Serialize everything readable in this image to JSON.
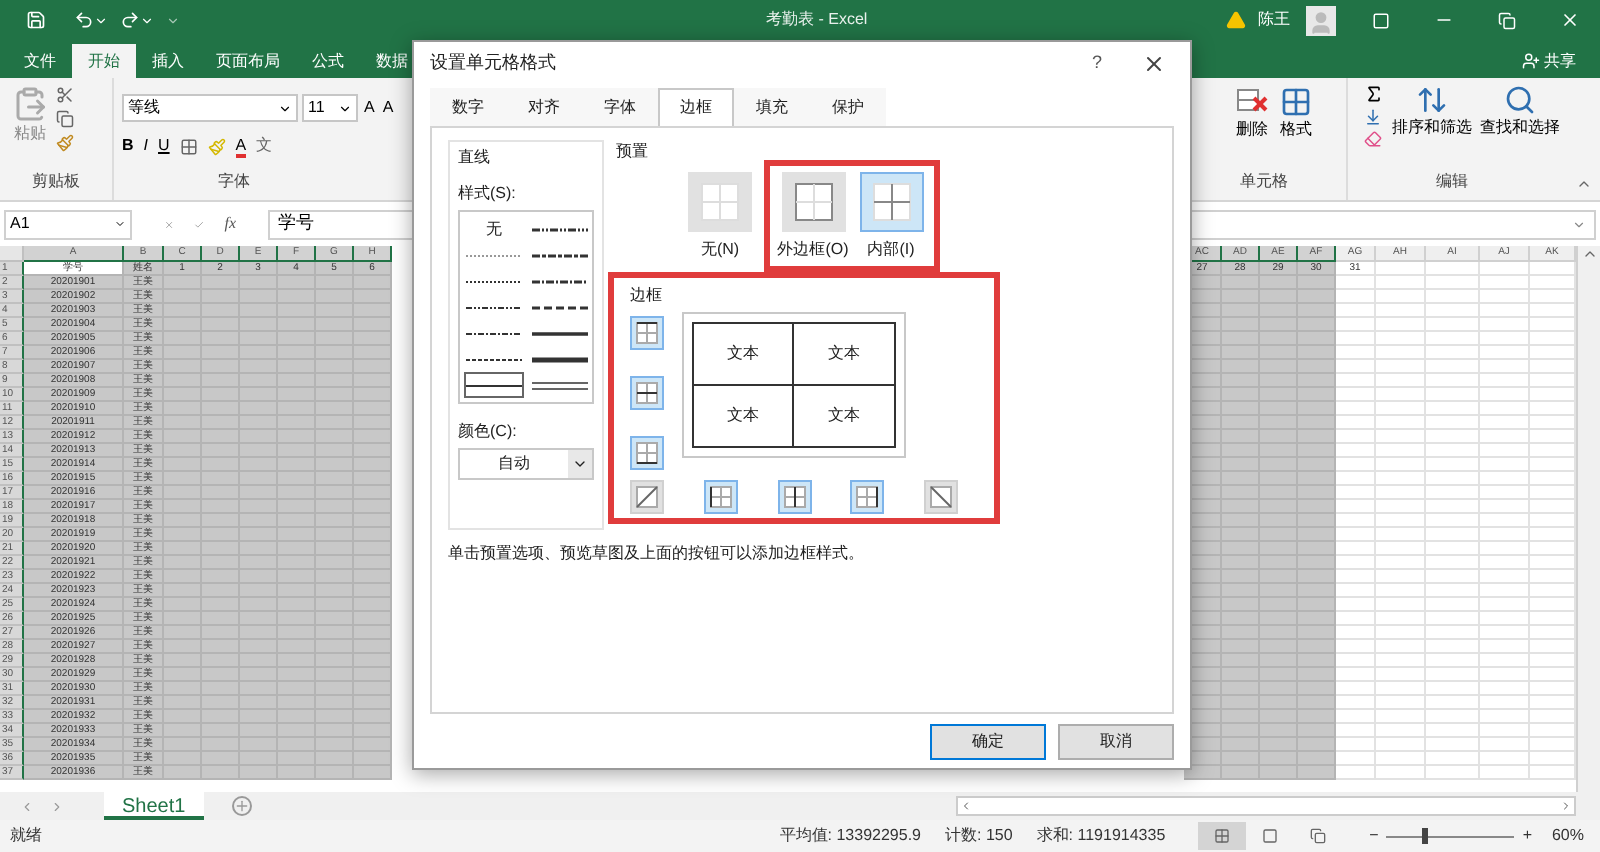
{
  "title_bar": {
    "title": "考勤表 - Excel",
    "user": "陈王"
  },
  "ribbon_tabs": [
    {
      "label": "文件",
      "selected": false
    },
    {
      "label": "开始",
      "selected": true
    },
    {
      "label": "插入",
      "selected": false
    },
    {
      "label": "页面布局",
      "selected": false
    },
    {
      "label": "公式",
      "selected": false
    },
    {
      "label": "数据",
      "selected": false
    }
  ],
  "share": "共享",
  "ribbon": {
    "paste": "粘贴",
    "clipboard_label": "剪贴板",
    "font_name": "等线",
    "font_size": "11",
    "grow_shrink": [
      "A",
      "A"
    ],
    "styles": [
      "B",
      "I",
      "U"
    ],
    "font_color": "A",
    "phonetic": "文",
    "font_label": "字体",
    "delete": "删除",
    "format": "格式",
    "cells_label": "单元格",
    "sort": "排序和筛选",
    "find": "查找和选择",
    "editing_label": "编辑"
  },
  "formula_bar": {
    "name_box": "A1",
    "fx": "fx",
    "content": "学号"
  },
  "sheet": {
    "left_columns": [
      {
        "label": "A",
        "selected": true
      },
      {
        "label": "B",
        "selected": true
      },
      {
        "label": "C",
        "selected": true
      },
      {
        "label": "D",
        "selected": true
      },
      {
        "label": "E",
        "selected": true
      },
      {
        "label": "F",
        "selected": true
      },
      {
        "label": "G",
        "selected": true
      },
      {
        "label": "H",
        "selected": true
      }
    ],
    "right_columns": [
      {
        "label": "AC",
        "selected": true
      },
      {
        "label": "AD",
        "selected": true
      },
      {
        "label": "AE",
        "selected": true
      },
      {
        "label": "AF",
        "selected": true
      },
      {
        "label": "AG",
        "selected": false
      },
      {
        "label": "AH",
        "selected": false
      },
      {
        "label": "AI",
        "selected": false
      },
      {
        "label": "AJ",
        "selected": false
      },
      {
        "label": "AK",
        "selected": false
      }
    ],
    "rows": [
      {
        "n": "1",
        "active": true,
        "cells": [
          "学号",
          "姓名",
          "1",
          "2",
          "3",
          "4",
          "5",
          "6"
        ],
        "right_cells": [
          "27",
          "28",
          "29",
          "30",
          "31"
        ]
      },
      {
        "n": "2",
        "cells": [
          "20201901",
          "王美"
        ]
      },
      {
        "n": "3",
        "cells": [
          "20201902",
          "王美"
        ]
      },
      {
        "n": "4",
        "cells": [
          "20201903",
          "王美"
        ]
      },
      {
        "n": "5",
        "cells": [
          "20201904",
          "王美"
        ]
      },
      {
        "n": "6",
        "cells": [
          "20201905",
          "王美"
        ]
      },
      {
        "n": "7",
        "cells": [
          "20201906",
          "王美"
        ]
      },
      {
        "n": "8",
        "cells": [
          "20201907",
          "王美"
        ]
      },
      {
        "n": "9",
        "cells": [
          "20201908",
          "王美"
        ]
      },
      {
        "n": "10",
        "cells": [
          "20201909",
          "王美"
        ]
      },
      {
        "n": "11",
        "cells": [
          "20201910",
          "王美"
        ]
      },
      {
        "n": "12",
        "cells": [
          "20201911",
          "王美"
        ]
      },
      {
        "n": "13",
        "cells": [
          "20201912",
          "王美"
        ]
      },
      {
        "n": "14",
        "cells": [
          "20201913",
          "王美"
        ]
      },
      {
        "n": "15",
        "cells": [
          "20201914",
          "王美"
        ]
      },
      {
        "n": "16",
        "cells": [
          "20201915",
          "王美"
        ]
      },
      {
        "n": "17",
        "cells": [
          "20201916",
          "王美"
        ]
      },
      {
        "n": "18",
        "cells": [
          "20201917",
          "王美"
        ]
      },
      {
        "n": "19",
        "cells": [
          "20201918",
          "王美"
        ]
      },
      {
        "n": "20",
        "cells": [
          "20201919",
          "王美"
        ]
      },
      {
        "n": "21",
        "cells": [
          "20201920",
          "王美"
        ]
      },
      {
        "n": "22",
        "cells": [
          "20201921",
          "王美"
        ]
      },
      {
        "n": "23",
        "cells": [
          "20201922",
          "王美"
        ]
      },
      {
        "n": "24",
        "cells": [
          "20201923",
          "王美"
        ]
      },
      {
        "n": "25",
        "cells": [
          "20201924",
          "王美"
        ]
      },
      {
        "n": "26",
        "cells": [
          "20201925",
          "王美"
        ]
      },
      {
        "n": "27",
        "cells": [
          "20201926",
          "王美"
        ]
      },
      {
        "n": "28",
        "cells": [
          "20201927",
          "王美"
        ]
      },
      {
        "n": "29",
        "cells": [
          "20201928",
          "王美"
        ]
      },
      {
        "n": "30",
        "cells": [
          "20201929",
          "王美"
        ]
      },
      {
        "n": "31",
        "cells": [
          "20201930",
          "王美"
        ]
      },
      {
        "n": "32",
        "cells": [
          "20201931",
          "王美"
        ]
      },
      {
        "n": "33",
        "cells": [
          "20201932",
          "王美"
        ]
      },
      {
        "n": "34",
        "cells": [
          "20201933",
          "王美"
        ]
      },
      {
        "n": "35",
        "cells": [
          "20201934",
          "王美"
        ]
      },
      {
        "n": "36",
        "cells": [
          "20201935",
          "王美"
        ]
      },
      {
        "n": "37",
        "cells": [
          "20201936",
          "王美"
        ]
      }
    ]
  },
  "sheet_tabs": [
    {
      "label": "Sheet1",
      "selected": true
    }
  ],
  "status_bar": {
    "ready": "就绪",
    "average": "平均值: 13392295.9",
    "count": "计数: 150",
    "sum": "求和: 1191914335",
    "views": [
      {
        "kind": "normal",
        "selected": true
      },
      {
        "kind": "layout",
        "selected": false
      },
      {
        "kind": "pagebreak",
        "selected": false
      }
    ],
    "zoom_minus": "−",
    "zoom": {
      "level": 0.3
    },
    "zoom_plus": "+",
    "zoom_text": "60%"
  },
  "dialog": {
    "title": "设置单元格格式",
    "help": "?",
    "tabs": [
      {
        "label": "数字",
        "selected": false
      },
      {
        "label": "对齐",
        "selected": false
      },
      {
        "label": "字体",
        "selected": false
      },
      {
        "label": "边框",
        "selected": true
      },
      {
        "label": "填充",
        "selected": false
      },
      {
        "label": "保护",
        "selected": false
      }
    ],
    "line_label": "直线",
    "style_label": "样式(S):",
    "styles": [
      {
        "kind": "none",
        "label": "无",
        "selected": false
      },
      {
        "kind": "hair",
        "selected": false
      },
      {
        "kind": "dotted",
        "selected": false
      },
      {
        "kind": "dashdotdot",
        "selected": false
      },
      {
        "kind": "dashdot",
        "selected": false
      },
      {
        "kind": "dashed",
        "selected": false
      },
      {
        "kind": "thin",
        "selected": true
      },
      {
        "kind": "mdashdotdot",
        "selected": false
      },
      {
        "kind": "slantdashdot",
        "selected": false
      },
      {
        "kind": "mdashdot",
        "selected": false
      },
      {
        "kind": "mdashed",
        "selected": false
      },
      {
        "kind": "medium",
        "selected": false
      },
      {
        "kind": "thick",
        "selected": false
      },
      {
        "kind": "double",
        "selected": false
      }
    ],
    "color_label": "颜色(C):",
    "color_value": "自动",
    "preset_label": "预置",
    "presets": [
      {
        "kind": "none",
        "label": "无(N)",
        "selected": false,
        "highlighted": false
      },
      {
        "kind": "outline",
        "label": "外边框(O)",
        "selected": false,
        "highlighted": true
      },
      {
        "kind": "inside",
        "label": "内部(I)",
        "selected": true,
        "highlighted": true
      }
    ],
    "border_section": {
      "label": "边框",
      "highlighted": true,
      "side_toggles": [
        {
          "kind": "top",
          "on": true
        },
        {
          "kind": "middle",
          "on": true
        },
        {
          "kind": "bottom",
          "on": true
        }
      ],
      "bottom_toggles": [
        {
          "kind": "diag-up",
          "on": false
        },
        {
          "kind": "left",
          "on": true
        },
        {
          "kind": "center",
          "on": true
        },
        {
          "kind": "right",
          "on": true
        },
        {
          "kind": "diag-down",
          "on": false
        }
      ],
      "preview_texts": [
        "文本",
        "文本",
        "文本",
        "文本"
      ]
    },
    "hint": "单击预置选项、预览草图及上面的按钮可以添加边框样式。",
    "buttons": [
      {
        "label": "确定",
        "default": true
      },
      {
        "label": "取消",
        "default": false
      }
    ]
  }
}
